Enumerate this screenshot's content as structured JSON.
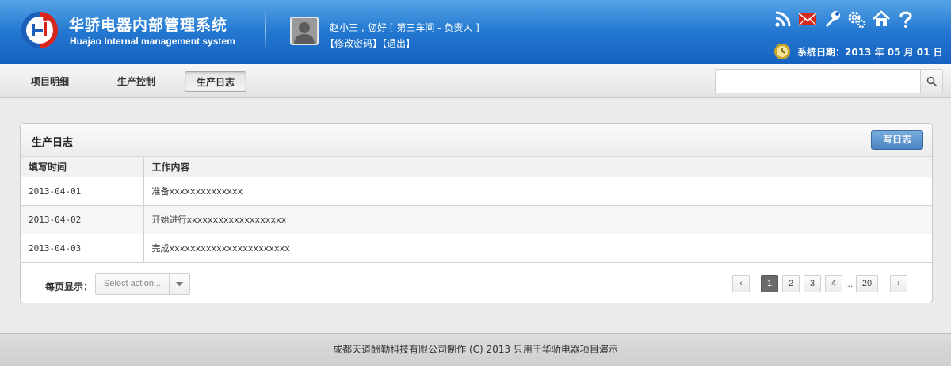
{
  "header": {
    "title": "华骄电器内部管理系统",
    "subtitle": "Huajao Internal management system",
    "user": {
      "name": "赵小三",
      "greeting": "您好",
      "role": "[ 第三车间 - 负责人 ]",
      "links": [
        "【修改密码】",
        "【退出】"
      ]
    },
    "icons": [
      "rss-icon",
      "mail-icon",
      "tools-icon",
      "settings-icon",
      "home-icon",
      "help-icon"
    ],
    "date_text": "系统日期：2013 年 05 月 01 日"
  },
  "nav": {
    "tabs": [
      {
        "label": "项目明细",
        "active": false
      },
      {
        "label": "生产控制",
        "active": false
      },
      {
        "label": "生产日志",
        "active": true
      }
    ],
    "search_placeholder": ""
  },
  "panel": {
    "title": "生产日志",
    "write_button": "写日志",
    "columns": [
      "填写时间",
      "工作内容"
    ],
    "rows": [
      {
        "date": "2013-04-01",
        "content": "准备xxxxxxxxxxxxxx"
      },
      {
        "date": "2013-04-02",
        "content": "开始进行xxxxxxxxxxxxxxxxxxx"
      },
      {
        "date": "2013-04-03",
        "content": "完成xxxxxxxxxxxxxxxxxxxxxxx"
      }
    ],
    "per_page_label": "每页显示：",
    "select_placeholder": "Select action...",
    "pagination": {
      "prev": "‹",
      "next": "›",
      "pages": [
        "1",
        "2",
        "3",
        "4"
      ],
      "ellipsis": "...",
      "last": "20",
      "current": "1"
    }
  },
  "footer": {
    "text": "成都天道酬勤科技有限公司制作 (C) 2013 只用于华骄电器项目演示"
  },
  "colors": {
    "header_top": "#2f8de0",
    "header_bottom": "#1662c0",
    "accent_button": "#4a82c0",
    "page_current": "#6a6a6a"
  }
}
